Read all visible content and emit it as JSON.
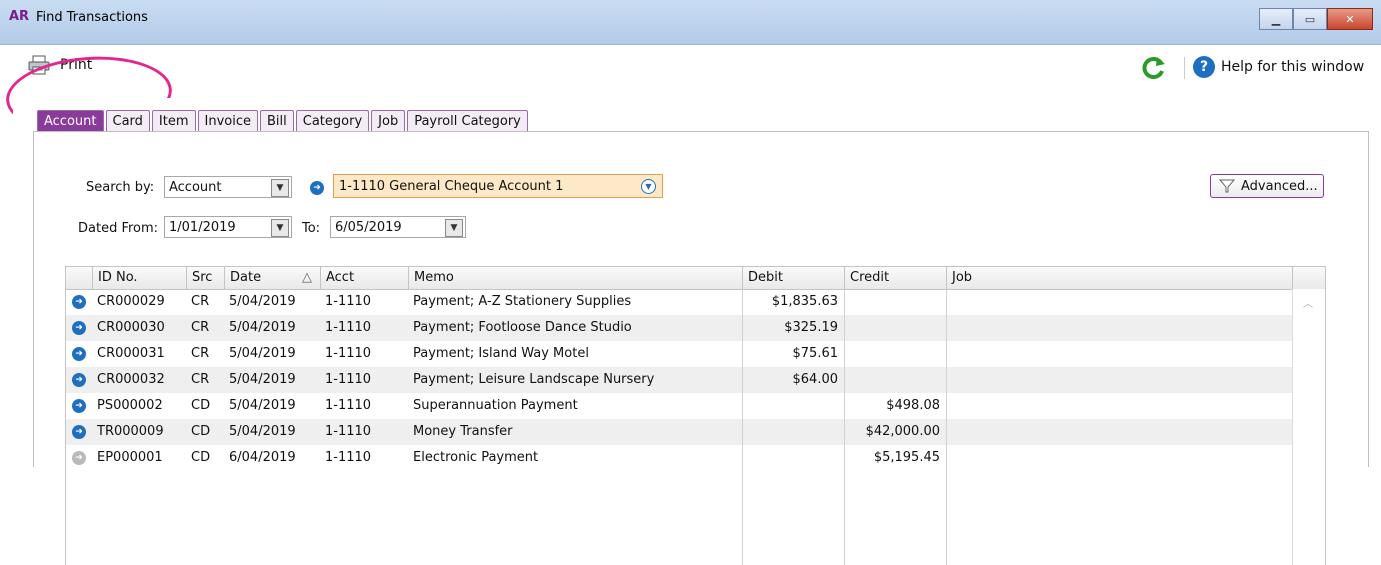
{
  "window": {
    "app_badge": "AR",
    "title": "Find Transactions",
    "controls": [
      "minimize",
      "maximize",
      "close"
    ]
  },
  "toolbar": {
    "print_label": "Print",
    "help_label": "Help for this window"
  },
  "tabs": [
    {
      "label": "Account",
      "active": true
    },
    {
      "label": "Card",
      "active": false
    },
    {
      "label": "Item",
      "active": false
    },
    {
      "label": "Invoice",
      "active": false
    },
    {
      "label": "Bill",
      "active": false
    },
    {
      "label": "Category",
      "active": false
    },
    {
      "label": "Job",
      "active": false
    },
    {
      "label": "Payroll Category",
      "active": false
    }
  ],
  "filters": {
    "search_by_label": "Search by:",
    "search_by_value": "Account",
    "account_value": "1-1110 General Cheque Account 1",
    "dated_from_label": "Dated From:",
    "dated_from_value": "1/01/2019",
    "to_label": "To:",
    "to_value": "6/05/2019",
    "advanced_label": "Advanced..."
  },
  "table": {
    "columns": [
      "ID No.",
      "Src",
      "Date",
      "Acct",
      "Memo",
      "Debit",
      "Credit",
      "Job"
    ],
    "sort_indicator": "△",
    "rows": [
      {
        "id": "CR000029",
        "src": "CR",
        "date": "5/04/2019",
        "acct": "1-1110",
        "memo": "Payment; A-Z Stationery Supplies",
        "debit": "$1,835.63",
        "credit": "",
        "job": ""
      },
      {
        "id": "CR000030",
        "src": "CR",
        "date": "5/04/2019",
        "acct": "1-1110",
        "memo": "Payment; Footloose Dance Studio",
        "debit": "$325.19",
        "credit": "",
        "job": ""
      },
      {
        "id": "CR000031",
        "src": "CR",
        "date": "5/04/2019",
        "acct": "1-1110",
        "memo": "Payment; Island Way Motel",
        "debit": "$75.61",
        "credit": "",
        "job": ""
      },
      {
        "id": "CR000032",
        "src": "CR",
        "date": "5/04/2019",
        "acct": "1-1110",
        "memo": "Payment; Leisure Landscape Nursery",
        "debit": "$64.00",
        "credit": "",
        "job": ""
      },
      {
        "id": "PS000002",
        "src": "CD",
        "date": "5/04/2019",
        "acct": "1-1110",
        "memo": "Superannuation Payment",
        "debit": "",
        "credit": "$498.08",
        "job": ""
      },
      {
        "id": "TR000009",
        "src": "CD",
        "date": "5/04/2019",
        "acct": "1-1110",
        "memo": "Money Transfer",
        "debit": "",
        "credit": "$42,000.00",
        "job": ""
      },
      {
        "id": "EP000001",
        "src": "CD",
        "date": "6/04/2019",
        "acct": "1-1110",
        "memo": "Electronic Payment",
        "debit": "",
        "credit": "$5,195.45",
        "job": ""
      }
    ]
  },
  "colors": {
    "accent": "#8a3a9a",
    "highlight_ring": "#e2288e",
    "link_blue": "#1f6fc0",
    "combo_bg": "#fde9c8"
  }
}
